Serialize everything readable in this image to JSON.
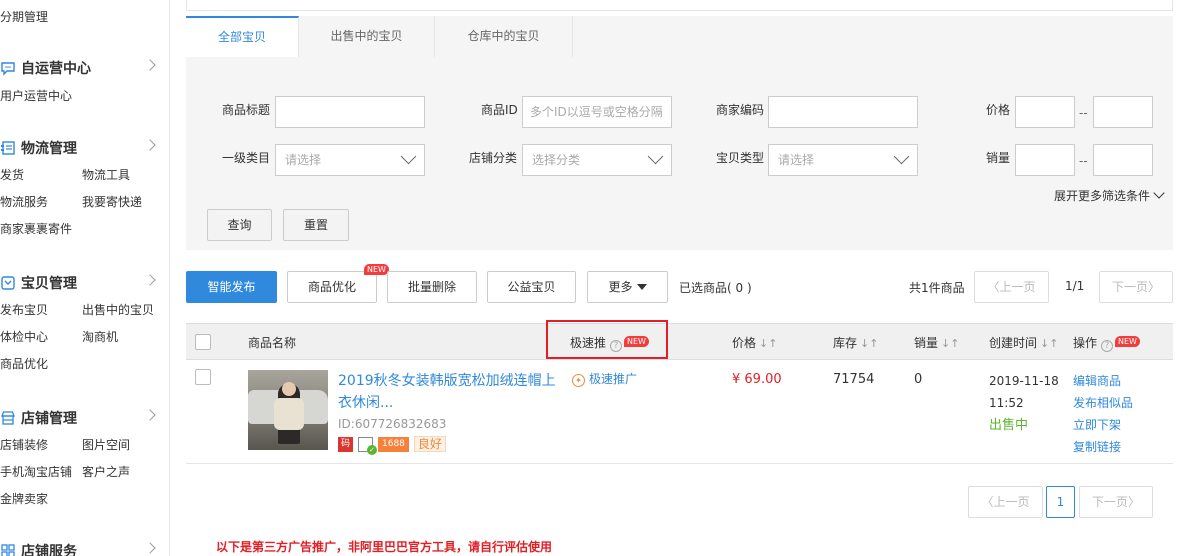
{
  "sidebar": {
    "top_label": "分期管理",
    "sections": [
      {
        "title": "自运营中心",
        "icon": "chat-bubble-icon",
        "items": [
          "用户运营中心"
        ]
      },
      {
        "title": "物流管理",
        "icon": "logistics-list-icon",
        "items": [
          "发货",
          "物流工具",
          "物流服务",
          "我要寄快递",
          "商家裹裹寄件"
        ]
      },
      {
        "title": "宝贝管理",
        "icon": "goods-box-icon",
        "items": [
          "发布宝贝",
          "出售中的宝贝",
          "体检中心",
          "淘商机",
          "商品优化"
        ]
      },
      {
        "title": "店铺管理",
        "icon": "shop-icon",
        "items": [
          "店铺装修",
          "图片空间",
          "手机淘宝店铺",
          "客户之声",
          "金牌卖家"
        ]
      },
      {
        "title": "店铺服务",
        "icon": "grid-icon",
        "items": []
      }
    ]
  },
  "tabs": [
    "全部宝贝",
    "出售中的宝贝",
    "仓库中的宝贝"
  ],
  "filters": {
    "title_label": "商品标题",
    "id_label": "商品ID",
    "id_placeholder": "多个ID以逗号或空格分隔",
    "code_label": "商家编码",
    "price_label": "价格",
    "category_label": "一级类目",
    "category_placeholder": "请选择",
    "shopcat_label": "店铺分类",
    "shopcat_placeholder": "选择分类",
    "type_label": "宝贝类型",
    "type_placeholder": "请选择",
    "sales_label": "销量",
    "range_sep": "--",
    "more_filters": "展开更多筛选条件",
    "query_btn": "查询",
    "reset_btn": "重置"
  },
  "toolbar": {
    "smart_publish": "智能发布",
    "optimize": "商品优化",
    "new_badge": "NEW",
    "batch_delete": "批量删除",
    "charity": "公益宝贝",
    "more": "更多",
    "selected": "已选商品( 0 )",
    "total": "共1件商品",
    "prev": "上一页",
    "page_info": "1/1",
    "next": "下一页"
  },
  "table": {
    "headers": {
      "name": "商品名称",
      "promo": "极速推",
      "price": "价格",
      "stock": "库存",
      "sales": "销量",
      "created": "创建时间",
      "ops": "操作"
    },
    "sort_glyph": "↓↑",
    "help_glyph": "?",
    "rows": [
      {
        "name": "2019秋冬女装韩版宽松加绒连帽上衣休闲...",
        "id": "ID:607726832683",
        "tag_red": "码",
        "tag_1688": "1688",
        "tag_good": "良好",
        "promo": "极速推广",
        "price": "¥ 69.00",
        "stock": "71754",
        "sales": "0",
        "created": "2019-11-18 11:52",
        "status": "出售中",
        "ops": [
          "编辑商品",
          "发布相似品",
          "立即下架",
          "复制链接"
        ]
      }
    ]
  },
  "pager": {
    "prev": "上一页",
    "current": "1",
    "next": "下一页"
  },
  "ad_notice": "以下是第三方广告推广，非阿里巴巴官方工具，请自行评估使用",
  "colors": {
    "accent": "#3089dc",
    "price": "#e31e24",
    "status": "#5cb531",
    "badge": "#f23d3d"
  }
}
